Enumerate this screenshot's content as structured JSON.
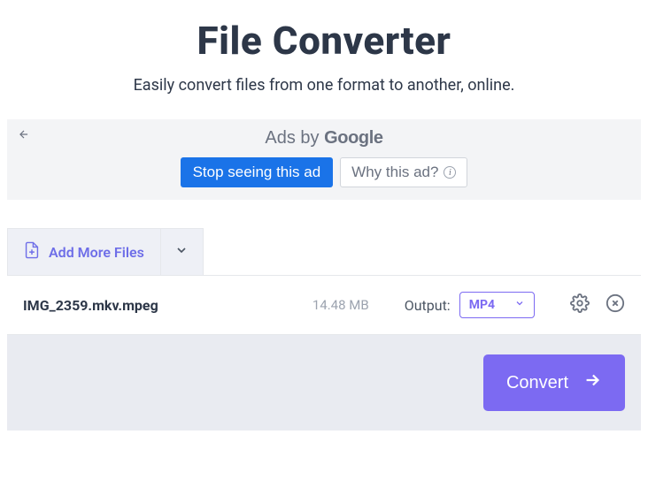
{
  "header": {
    "title": "File Converter",
    "subtitle": "Easily convert files from one format to another, online."
  },
  "ad": {
    "ads_by": "Ads by ",
    "google": "Google",
    "stop_label": "Stop seeing this ad",
    "why_label": "Why this ad?"
  },
  "toolbar": {
    "add_more_label": "Add More Files"
  },
  "file": {
    "name": "IMG_2359.mkv.mpeg",
    "size": "14.48 MB",
    "output_label": "Output:",
    "output_value": "MP4"
  },
  "footer": {
    "convert_label": "Convert"
  }
}
